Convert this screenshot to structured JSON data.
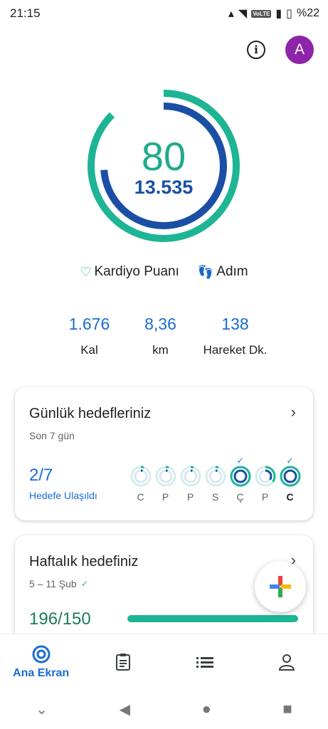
{
  "status_bar": {
    "time": "21:15",
    "network_badge": "VoLTE",
    "battery": "%22"
  },
  "header": {
    "info_icon": "info-icon",
    "avatar_letter": "A",
    "avatar_color": "#8e24aa"
  },
  "ring": {
    "points": "80",
    "steps": "13.535",
    "outer_color": "#1eb594",
    "inner_color": "#1a4fa5"
  },
  "legend": {
    "cardio_label": "Kardiyo Puanı",
    "steps_label": "Adım"
  },
  "stats": [
    {
      "value": "1.676",
      "label": "Kal"
    },
    {
      "value": "8,36",
      "label": "km"
    },
    {
      "value": "138",
      "label": "Hareket Dk."
    }
  ],
  "daily_goals": {
    "title": "Günlük hedefleriniz",
    "subtitle": "Son 7 gün",
    "count": "2/7",
    "count_label": "Hedefe Ulaşıldı",
    "days": [
      {
        "label": "C",
        "achieved": false,
        "today": false,
        "progress": 0.05
      },
      {
        "label": "P",
        "achieved": false,
        "today": false,
        "progress": 0.05
      },
      {
        "label": "P",
        "achieved": false,
        "today": false,
        "progress": 0.05
      },
      {
        "label": "S",
        "achieved": false,
        "today": false,
        "progress": 0.05
      },
      {
        "label": "Ç",
        "achieved": true,
        "today": false,
        "progress": 1.0
      },
      {
        "label": "P",
        "achieved": false,
        "today": false,
        "progress": 0.35
      },
      {
        "label": "C",
        "achieved": true,
        "today": true,
        "progress": 1.0
      }
    ]
  },
  "weekly_goal": {
    "title": "Haftalık hedefiniz",
    "date_range": "5 – 11 Şub",
    "count": "196/150",
    "progress": 1.0
  },
  "bottom_nav": {
    "home_label": "Ana Ekran"
  }
}
